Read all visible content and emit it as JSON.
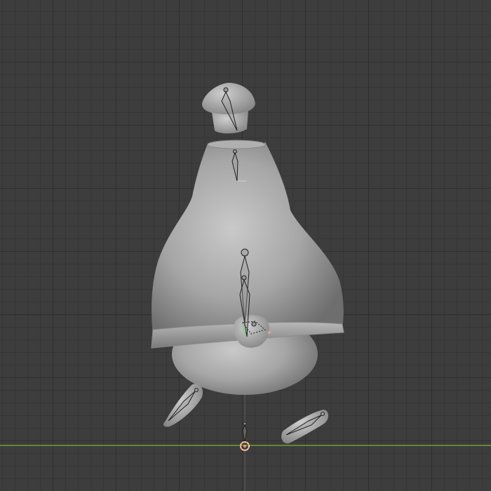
{
  "viewport": {
    "background": "#3d3d3d",
    "grid_major": "#2f2f2f",
    "grid_minor": "#363636",
    "ground_axis_color": "#6c9f3a",
    "vertical_axis_color": "#5a5a5a"
  },
  "model": {
    "mesh_color": "#a6a6a6",
    "mesh_shadow": "#6e6e6e",
    "mesh_highlight": "#c9c9c9",
    "bone_color": "#1f1f1f",
    "bone_fill": "#9a9a9a",
    "selected_bone_color": "#7bd07b",
    "origin_color": "#e8a070",
    "parts": [
      "head-cap",
      "head",
      "upper-body",
      "lower-body",
      "brim",
      "hand",
      "left-foot",
      "right-foot"
    ]
  },
  "icons": {
    "origin": "3d-cursor-icon"
  }
}
